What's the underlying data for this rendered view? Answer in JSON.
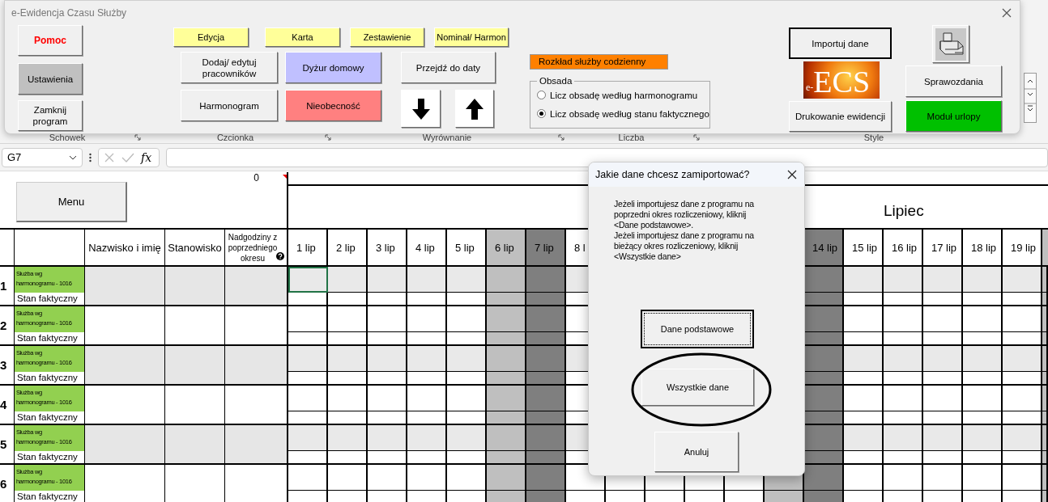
{
  "ribbon": {
    "groups": [
      {
        "label": "Schowek",
        "launcher": true
      },
      {
        "label": "Czcionka",
        "launcher": true
      },
      {
        "label": "Wyrównanie",
        "launcher": true
      },
      {
        "label": "Liczba",
        "launcher": true
      },
      {
        "label": "Style",
        "launcher": false
      }
    ]
  },
  "formula_bar": {
    "name_box": "G7",
    "fx": "fx"
  },
  "form": {
    "title": "e-Ewidencja Czasu Służby",
    "buttons": [
      {
        "label": "Pomoc",
        "kind": "help"
      },
      {
        "label": "Ustawienia",
        "kind": "grey"
      },
      {
        "label": "Zamknij program",
        "kind": "plain"
      },
      {
        "label": "Edycja",
        "kind": "yellow"
      },
      {
        "label": "Karta",
        "kind": "yellow"
      },
      {
        "label": "Zestawienie",
        "kind": "yellow"
      },
      {
        "label": "Nominał/ Harmon",
        "kind": "yellow"
      },
      {
        "label": "Dodaj/ edytuj pracowników",
        "kind": "plain"
      },
      {
        "label": "Dyżur domowy",
        "kind": "lavender"
      },
      {
        "label": "Przejdź do daty",
        "kind": "plain"
      },
      {
        "label": "Harmonogram",
        "kind": "plain"
      },
      {
        "label": "Nieobecność",
        "kind": "red"
      },
      {
        "label": "Importuj dane",
        "kind": "default"
      },
      {
        "label": "Drukowanie ewidencji",
        "kind": "plain"
      },
      {
        "label": "Sprawozdania",
        "kind": "plain"
      },
      {
        "label": "Moduł urlopy",
        "kind": "green"
      }
    ],
    "banner": "Rozkład służby codzienny",
    "obsada": {
      "legend": "Obsada",
      "options": [
        {
          "label": "Licz obsadę według harmonogramu",
          "selected": false
        },
        {
          "label": "Licz obsadę według stanu faktycznego",
          "selected": true
        }
      ]
    },
    "logo": {
      "prefix": "e-",
      "text": "ECS"
    }
  },
  "sheet": {
    "menu_button": "Menu",
    "top_value": "0",
    "month": "Lipiec",
    "headers": [
      "Nazwisko i imię",
      "Stanowisko",
      "Nadgodziny z poprzedniego okresu"
    ],
    "days": [
      {
        "label": "1 lip",
        "kind": "weekday"
      },
      {
        "label": "2 lip",
        "kind": "weekday"
      },
      {
        "label": "3 lip",
        "kind": "weekday"
      },
      {
        "label": "4 lip",
        "kind": "weekday"
      },
      {
        "label": "5 lip",
        "kind": "weekday"
      },
      {
        "label": "6 lip",
        "kind": "saturday"
      },
      {
        "label": "7 lip",
        "kind": "sunday"
      },
      {
        "label": "8 l",
        "kind": "weekday"
      },
      {
        "kind": "weekday"
      },
      {
        "kind": "weekday"
      },
      {
        "kind": "weekday"
      },
      {
        "kind": "weekday"
      },
      {
        "kind": "saturday"
      },
      {
        "label": "14 lip",
        "kind": "sunday"
      },
      {
        "label": "15 lip",
        "kind": "weekday"
      },
      {
        "label": "16 lip",
        "kind": "weekday"
      },
      {
        "label": "17 lip",
        "kind": "weekday"
      },
      {
        "label": "18 lip",
        "kind": "weekday"
      },
      {
        "label": "19 lip",
        "kind": "weekday"
      },
      {
        "kind": "saturday"
      }
    ],
    "rows": [
      {
        "number": "1",
        "plan_label": "Służba wg\nharmonogramu - 1016",
        "actual_label": "Stan faktyczny",
        "shaded": true,
        "selected": true
      },
      {
        "number": "2",
        "plan_label": "Służba wg\nharmonogramu - 1016",
        "actual_label": "Stan faktyczny",
        "shaded": false,
        "selected": false
      },
      {
        "number": "3",
        "plan_label": "Służba wg\nharmonogramu - 1016",
        "actual_label": "Stan faktyczny",
        "shaded": true,
        "selected": false
      },
      {
        "number": "4",
        "plan_label": "Służba wg\nharmonogramu - 1016",
        "actual_label": "Stan faktyczny",
        "shaded": false,
        "selected": false
      },
      {
        "number": "5",
        "plan_label": "Służba wg\nharmonogramu - 1016",
        "actual_label": "Stan faktyczny",
        "shaded": true,
        "selected": false
      },
      {
        "number": "6",
        "plan_label": "Służba wg\nharmonogramu - 1016",
        "actual_label": "Stan faktyczny",
        "shaded": false,
        "selected": false
      }
    ]
  },
  "dialog": {
    "title": "Jakie dane chcesz zamiportować?",
    "paragraphs": [
      "Jeżeli importujesz dane z programu na\npoprzedni okres rozliczeniowy, kliknij\n<Dane podstawowe>.",
      "Jeżeli importujesz dane z programu na\nbieżący okres rozliczeniowy, kliknij\n<Wszystkie dane>"
    ],
    "buttons": [
      {
        "label": "Dane podstawowe",
        "focused": true,
        "circled": false
      },
      {
        "label": "Wszystkie dane",
        "focused": false,
        "circled": true
      },
      {
        "label": "Anuluj",
        "focused": false,
        "circled": false
      }
    ]
  }
}
